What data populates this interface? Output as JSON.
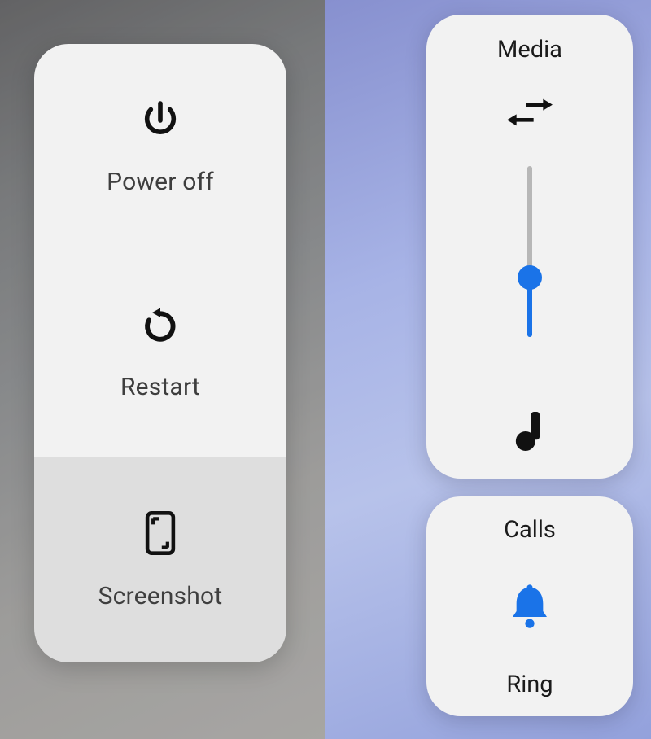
{
  "power_menu": {
    "power_off_label": "Power off",
    "restart_label": "Restart",
    "screenshot_label": "Screenshot"
  },
  "volume": {
    "media_title": "Media",
    "media_level_percent": 35,
    "calls_title": "Calls",
    "calls_mode_label": "Ring"
  },
  "colors": {
    "accent": "#1a73e8"
  }
}
